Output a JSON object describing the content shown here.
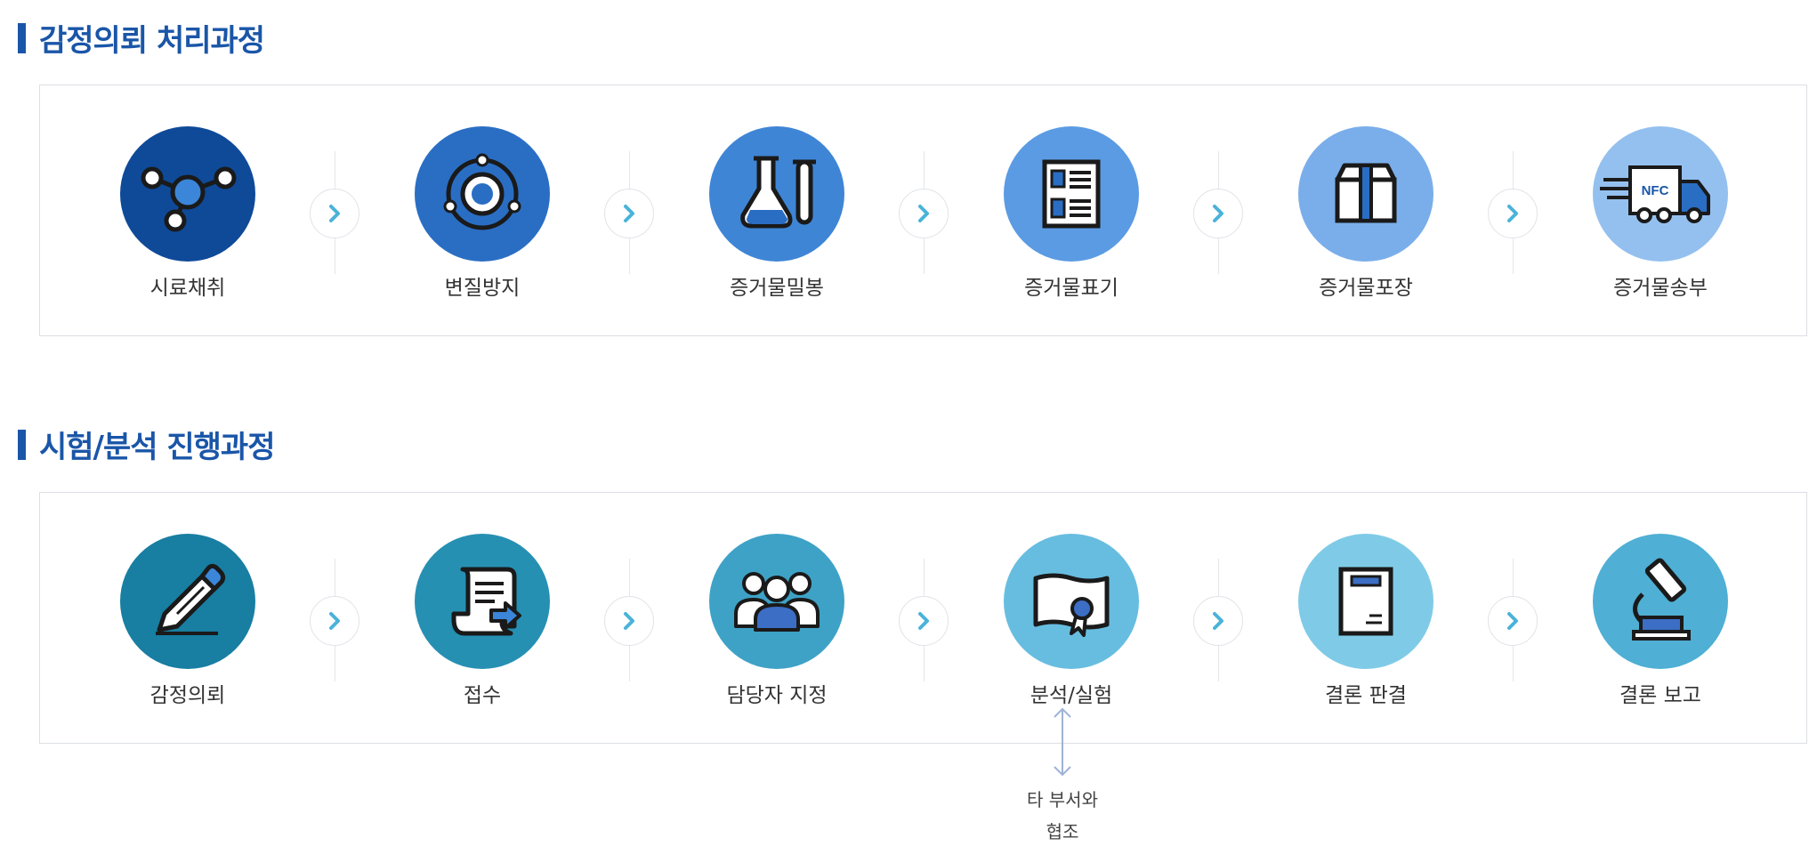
{
  "sections": [
    {
      "title": "감정의뢰 처리과정",
      "steps": [
        {
          "label": "시료채취",
          "icon": "molecule-icon",
          "color": "#0f4a99"
        },
        {
          "label": "변질방지",
          "icon": "orbit-icon",
          "color": "#2a6ec4"
        },
        {
          "label": "증거물밀봉",
          "icon": "flask-tube-icon",
          "color": "#3f85d6"
        },
        {
          "label": "증거물표기",
          "icon": "document-list-icon",
          "color": "#5b9be3"
        },
        {
          "label": "증거물포장",
          "icon": "box-icon",
          "color": "#7aaeea"
        },
        {
          "label": "증거물송부",
          "icon": "delivery-truck-icon",
          "color": "#94c0ef",
          "badge": "NFC"
        }
      ]
    },
    {
      "title": "시험/분석 진행과정",
      "steps": [
        {
          "label": "감정의뢰",
          "icon": "pencil-icon",
          "color": "#187ea2"
        },
        {
          "label": "접수",
          "icon": "scroll-icon",
          "color": "#2690b3"
        },
        {
          "label": "담당자 지정",
          "icon": "people-icon",
          "color": "#3ea2c6"
        },
        {
          "label": "분석/실험",
          "icon": "certificate-icon",
          "color": "#67bde0"
        },
        {
          "label": "결론 판결",
          "icon": "report-icon",
          "color": "#7fcbe7"
        },
        {
          "label": "결론 보고",
          "icon": "microscope-icon",
          "color": "#4fafd4"
        }
      ]
    }
  ],
  "note": {
    "text_line1": "타 부서와",
    "text_line2": "협조"
  },
  "colors": {
    "title": "#1a56a8",
    "arrow": "#4ab3d9"
  }
}
